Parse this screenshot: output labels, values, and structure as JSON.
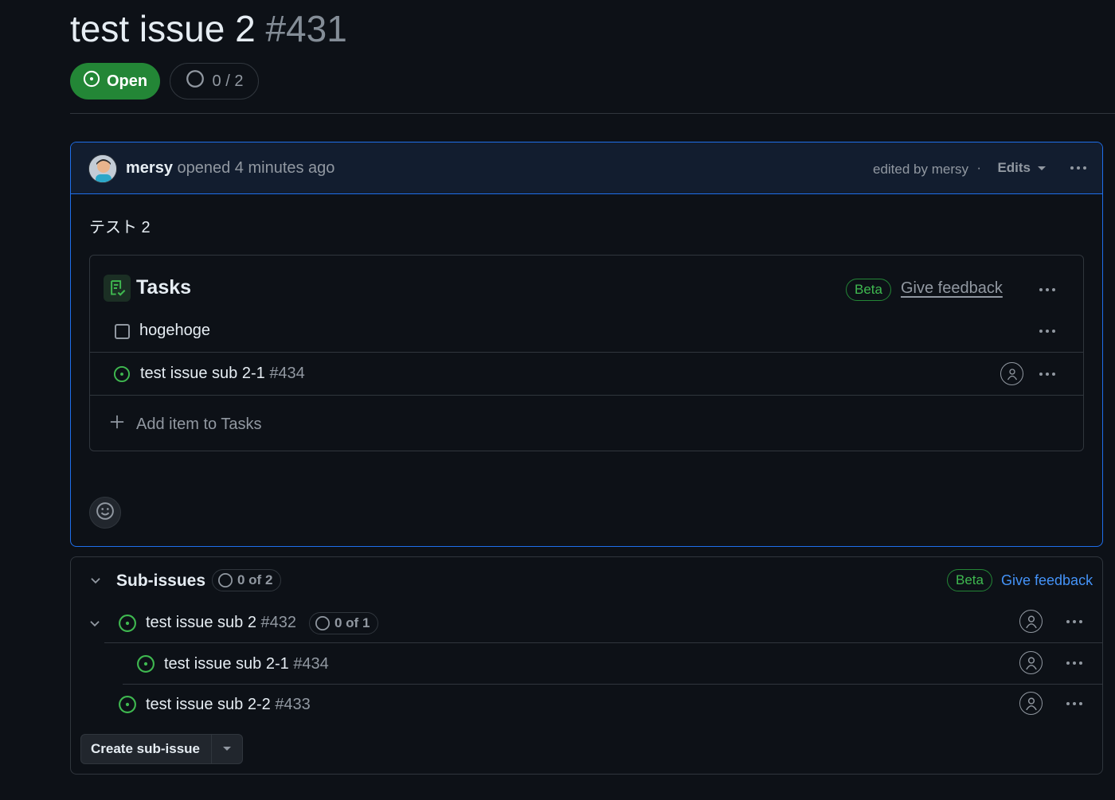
{
  "issue": {
    "title": "test issue 2",
    "number": "#431",
    "state_label": "Open",
    "progress": "0 / 2"
  },
  "comment": {
    "author": "mersy",
    "action": "opened 4 minutes ago",
    "edited_by": "edited by mersy",
    "separator": "·",
    "edits_label": "Edits",
    "body": "テスト 2"
  },
  "tasks": {
    "title": "Tasks",
    "beta": "Beta",
    "feedback": "Give feedback",
    "items": [
      {
        "type": "draft",
        "title": "hogehoge"
      },
      {
        "type": "issue",
        "title": "test issue sub 2-1",
        "number": "#434"
      }
    ],
    "add_item": "Add item to Tasks"
  },
  "subissues": {
    "title": "Sub-issues",
    "counter": "0 of 2",
    "beta": "Beta",
    "feedback": "Give feedback",
    "items": [
      {
        "title": "test issue sub 2",
        "number": "#432",
        "counter": "0 of 1"
      },
      {
        "title": "test issue sub 2-1",
        "number": "#434"
      },
      {
        "title": "test issue sub 2-2",
        "number": "#433"
      }
    ],
    "create_label": "Create sub-issue"
  },
  "colors": {
    "open_green": "#238636",
    "accent_blue": "#1f6feb",
    "link_blue": "#4493f8",
    "background": "#0d1117"
  }
}
